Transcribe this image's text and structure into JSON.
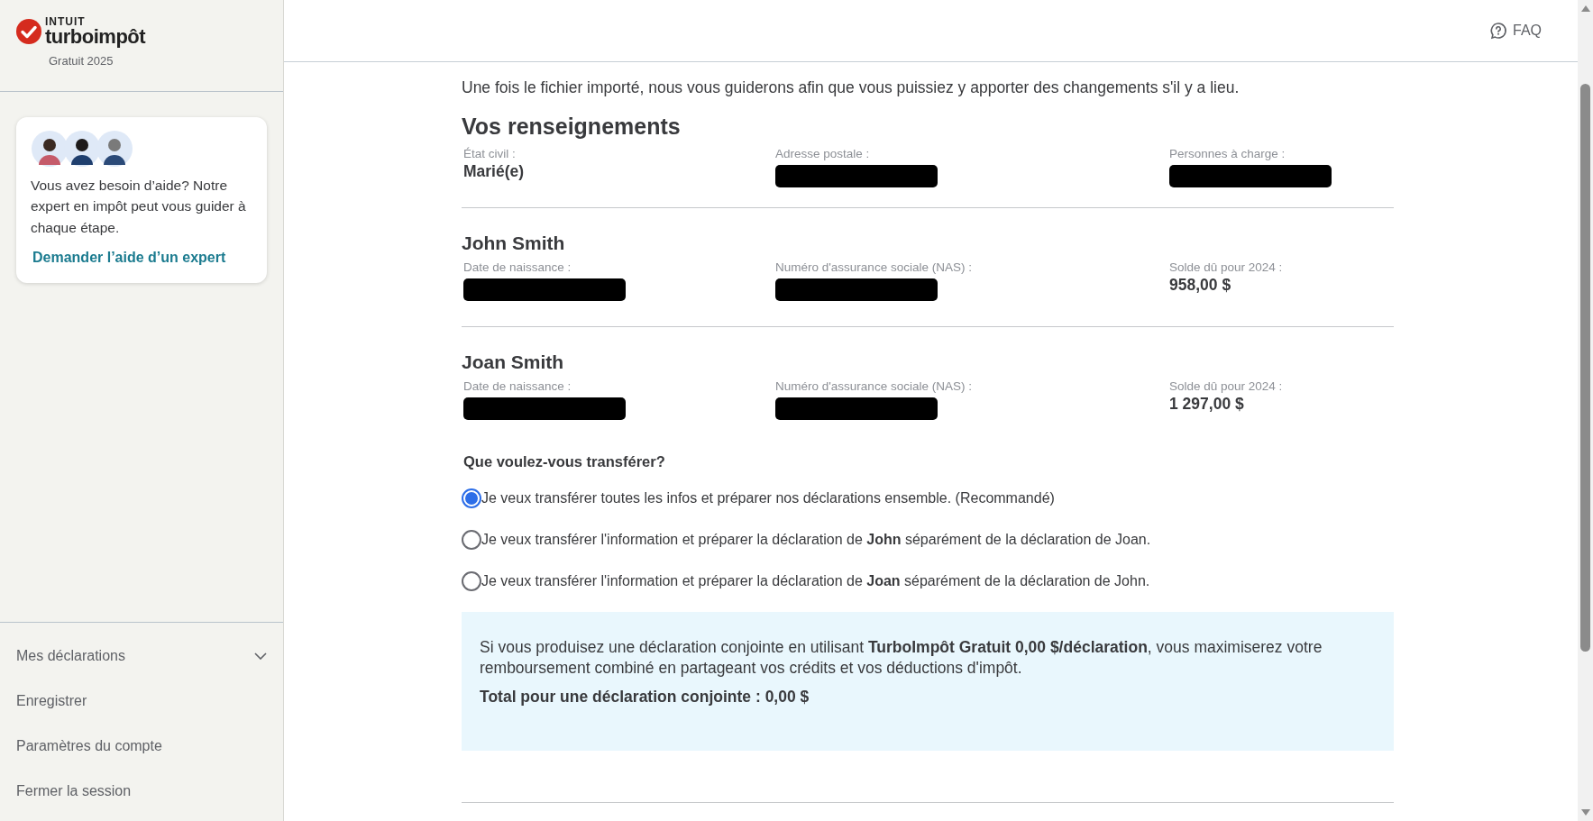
{
  "app": {
    "brand_top": "INTUIT",
    "brand_name": "turboimpôt",
    "edition": "Gratuit 2025"
  },
  "help_card": {
    "text": "Vous avez besoin d’aide? Notre expert en impôt peut vous guider à chaque étape.",
    "link": "Demander l’aide d’un expert"
  },
  "nav": [
    {
      "label": "Mes déclarations",
      "kind": "dropdown"
    },
    {
      "label": "Enregistrer",
      "kind": "link"
    },
    {
      "label": "Paramètres du compte",
      "kind": "link"
    },
    {
      "label": "Fermer la session",
      "kind": "link"
    }
  ],
  "header": {
    "faq": "FAQ"
  },
  "intro": "Une fois le fichier importé, nous vous guiderons afin que vous puissiez y apporter des changements s'il y a lieu.",
  "section": {
    "title": "Vos renseignements",
    "fields": [
      {
        "label": "État civil :",
        "value": "Marié(e)"
      },
      {
        "label": "Adresse postale :",
        "redacted": true
      },
      {
        "label": "Personnes à charge :",
        "redacted": true
      }
    ]
  },
  "people": [
    {
      "name": "John Smith",
      "fields": [
        {
          "label": "Date de naissance :",
          "redacted": true
        },
        {
          "label": "Numéro d'assurance sociale (NAS) :",
          "redacted": true
        },
        {
          "label": "Solde dû pour 2024 :",
          "value": "958,00 $"
        }
      ]
    },
    {
      "name": "Joan Smith",
      "fields": [
        {
          "label": "Date de naissance :",
          "redacted": true
        },
        {
          "label": "Numéro d'assurance sociale (NAS) :",
          "redacted": true
        },
        {
          "label": "Solde dû pour 2024 :",
          "value": "1 297,00 $"
        }
      ]
    }
  ],
  "question": {
    "title": "Que voulez-vous transférer?",
    "options": [
      {
        "label": "Je veux transférer toutes les infos et préparer nos déclarations ensemble. (Recommandé)",
        "selected": true
      },
      {
        "label": "Je veux transférer l'information et préparer la déclaration de **John** séparément de la déclaration de Joan.",
        "selected": false
      },
      {
        "label": "Je veux transférer l'information et préparer la déclaration de **Joan** séparément de la déclaration de John.",
        "selected": false
      }
    ]
  },
  "info": {
    "text": "Si vous produisez une déclaration conjointe en utilisant **TurboImpôt Gratuit 0,00 $/déclaration**, vous maximiserez votre remboursement combiné en partageant vos crédits et vos déductions d'impôt.",
    "total": "Total pour une déclaration conjointe : 0,00 $"
  }
}
